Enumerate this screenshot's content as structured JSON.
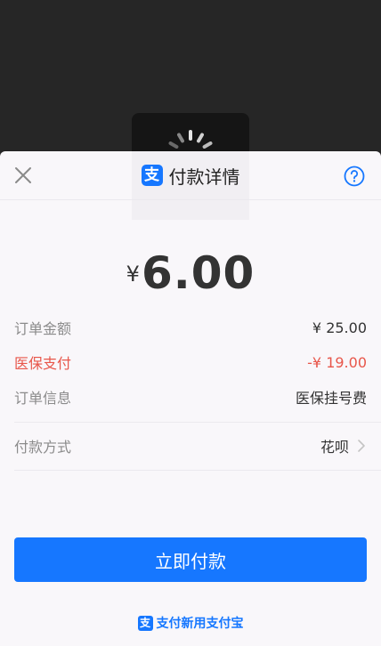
{
  "header": {
    "title": "付款详情",
    "logo_glyph": "支",
    "close_icon": "close-icon",
    "help_icon": "question-circle-icon"
  },
  "amount": {
    "currency": "¥",
    "value": "6.00"
  },
  "details": {
    "order_amount_label": "订单金额",
    "order_amount_value": "¥ 25.00",
    "insurance_label": "医保支付",
    "insurance_value": "-¥ 19.00",
    "order_info_label": "订单信息",
    "order_info_value": "医保挂号费"
  },
  "payment_method": {
    "label": "付款方式",
    "value": "花呗"
  },
  "pay_button": {
    "label": "立即付款"
  },
  "footer": {
    "logo_glyph": "支",
    "text": "支付新用支付宝"
  },
  "colors": {
    "accent": "#1677ff",
    "discount": "#e8564a",
    "sheet_bg": "#f9f7fa",
    "backdrop": "#262626"
  }
}
